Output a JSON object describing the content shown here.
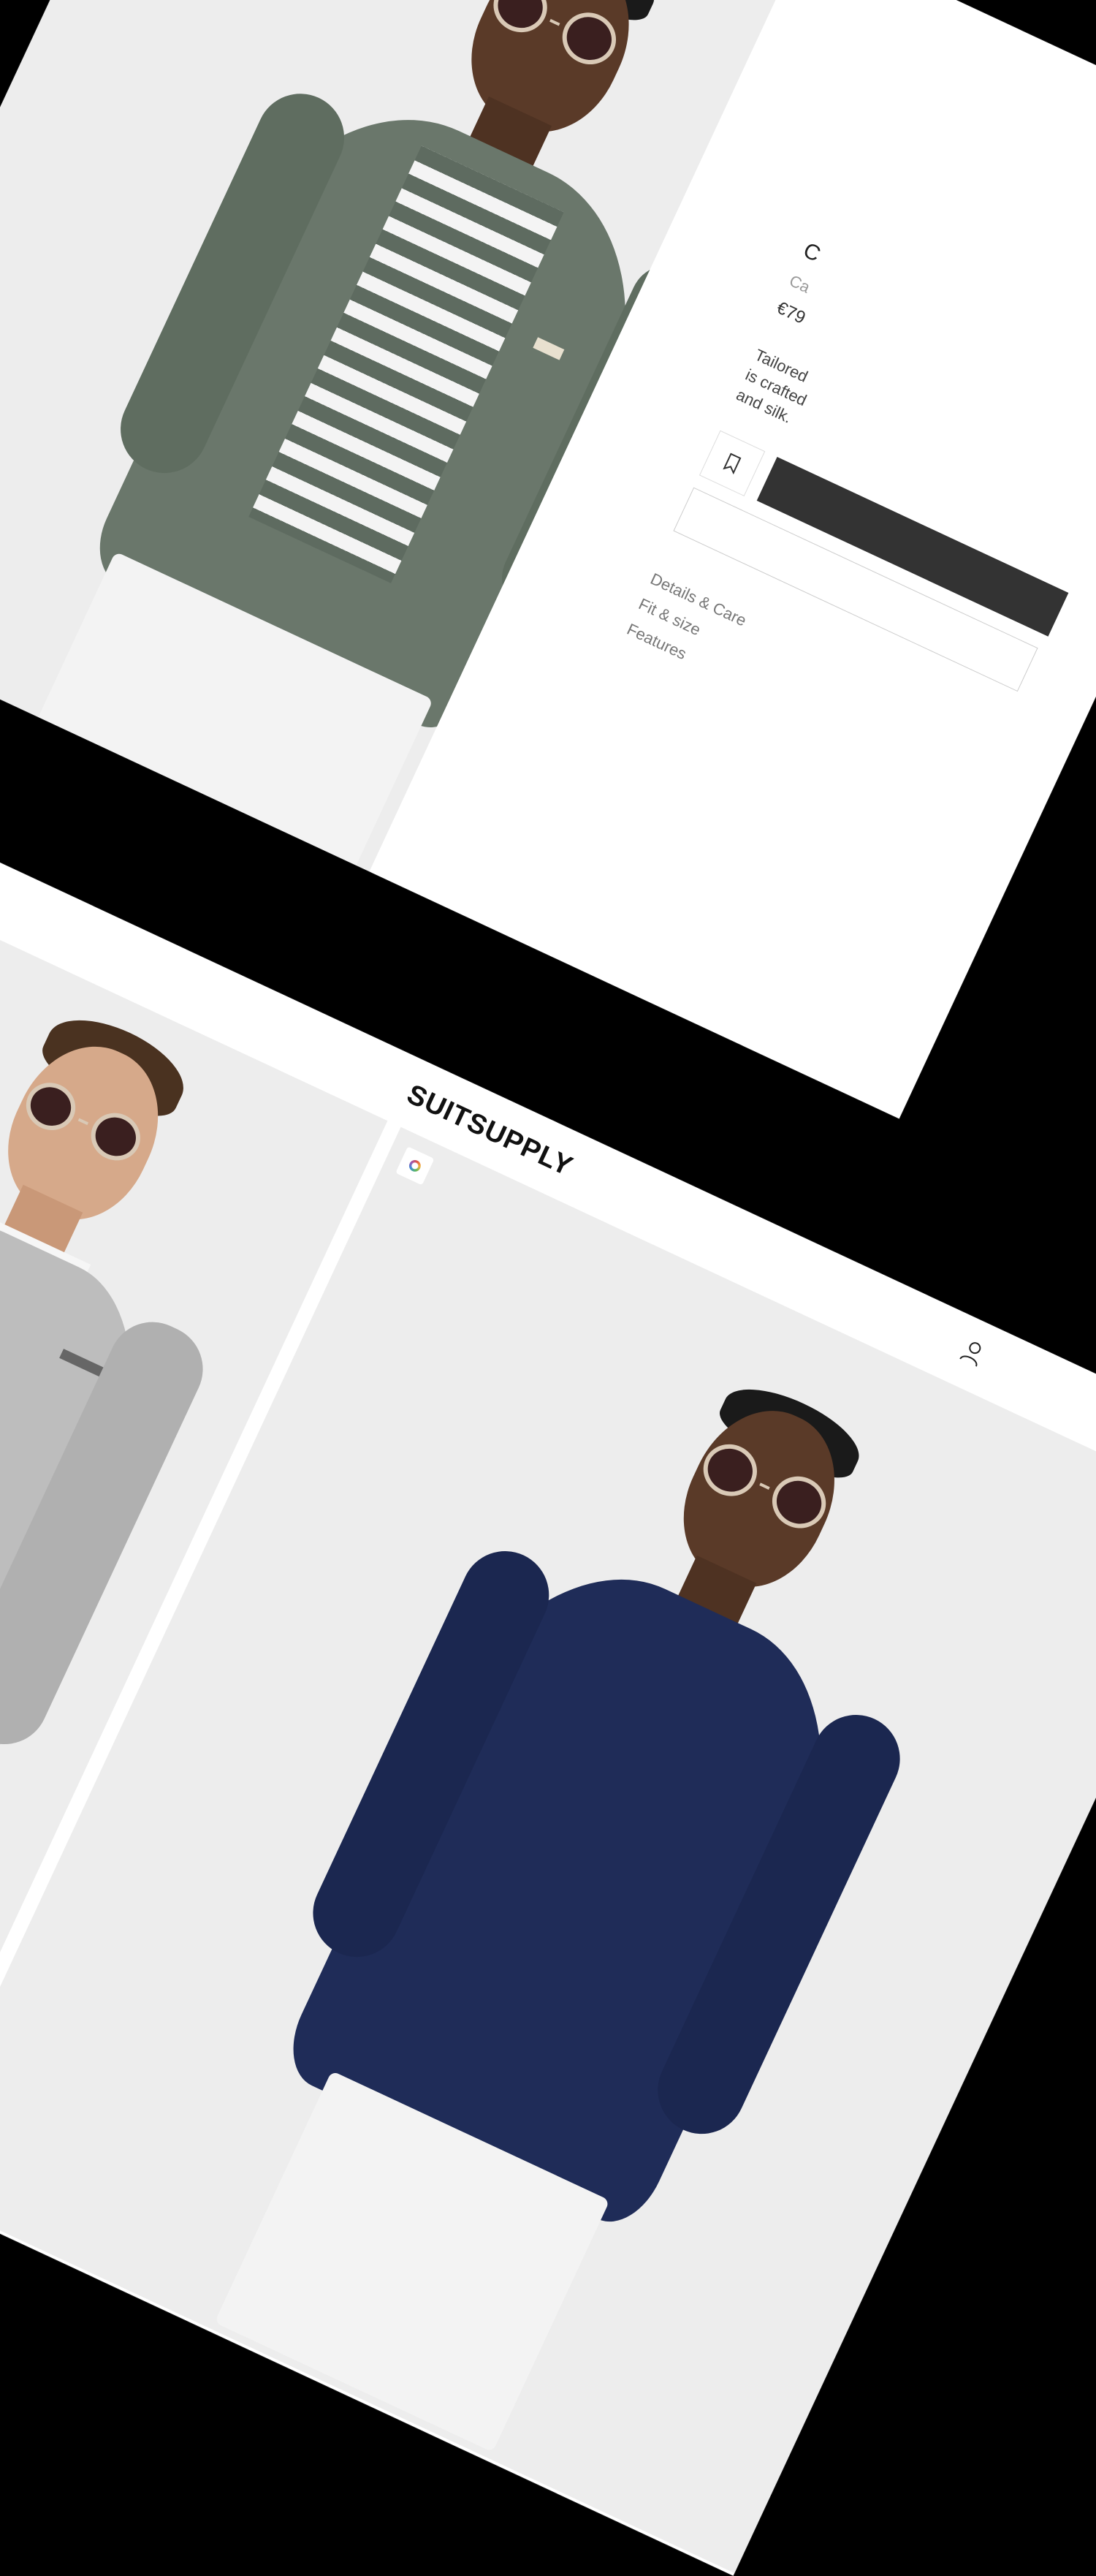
{
  "product": {
    "title": "C",
    "subtitle": "Ca",
    "price": "€79",
    "description_lines": [
      "Tailored",
      "is crafted",
      "and silk."
    ],
    "add_to_bag_label": "",
    "size_select_label": "",
    "accordion": [
      "Details & Care",
      "Fit & size",
      "Features"
    ]
  },
  "header": {
    "brand": "SUITSUPPLY"
  },
  "icons": {
    "wishlist": "bookmark-icon",
    "account": "user-icon",
    "color_selector": "color-ring-icon"
  },
  "colors": {
    "background": "#000000",
    "photo_bg": "#ededed",
    "green_jacket": "#5f6d60",
    "navy_jacket": "#1d2a55",
    "grey_jacket": "#b7b7b7",
    "button_dark": "#333333"
  }
}
